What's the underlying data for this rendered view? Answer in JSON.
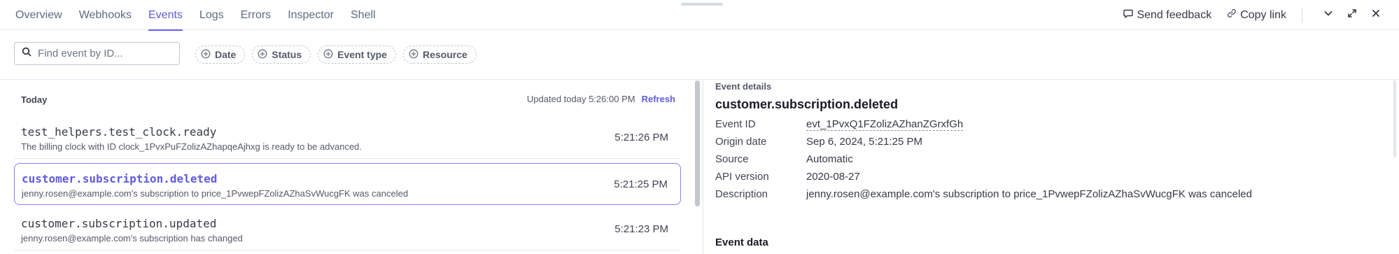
{
  "tabs": [
    {
      "label": "Overview"
    },
    {
      "label": "Webhooks"
    },
    {
      "label": "Events",
      "active": true
    },
    {
      "label": "Logs"
    },
    {
      "label": "Errors"
    },
    {
      "label": "Inspector"
    },
    {
      "label": "Shell"
    }
  ],
  "top_actions": {
    "feedback_label": "Send feedback",
    "copy_link_label": "Copy link"
  },
  "search": {
    "placeholder": "Find event by ID..."
  },
  "filters": [
    {
      "label": "Date"
    },
    {
      "label": "Status"
    },
    {
      "label": "Event type"
    },
    {
      "label": "Resource"
    }
  ],
  "list": {
    "section_title": "Today",
    "updated_text": "Updated today 5:26:00 PM",
    "refresh_label": "Refresh",
    "events": [
      {
        "type": "test_helpers.test_clock.ready",
        "description": "The billing clock with ID clock_1PvxPuFZolizAZhapqeAjhxg is ready to be advanced.",
        "time": "5:21:26 PM"
      },
      {
        "type": "customer.subscription.deleted",
        "description": "jenny.rosen@example.com's subscription to price_1PvwepFZolizAZhaSvWucgFK was canceled",
        "time": "5:21:25 PM",
        "selected": true
      },
      {
        "type": "customer.subscription.updated",
        "description": "jenny.rosen@example.com's subscription has changed",
        "time": "5:21:23 PM"
      }
    ]
  },
  "details": {
    "label": "Event details",
    "title": "customer.subscription.deleted",
    "fields": [
      {
        "key": "Event ID",
        "value": "evt_1PvxQ1FZolizAZhanZGrxfGh"
      },
      {
        "key": "Origin date",
        "value": "Sep 6, 2024, 5:21:25 PM"
      },
      {
        "key": "Source",
        "value": "Automatic"
      },
      {
        "key": "API version",
        "value": "2020-08-27"
      },
      {
        "key": "Description",
        "value": "jenny.rosen@example.com's subscription to price_1PvwepFZolizAZhaSvWucgFK was canceled"
      }
    ],
    "event_data_title": "Event data"
  },
  "colors": {
    "accent": "#635bff",
    "accent_text": "#5f5bdb",
    "border": "#e3e6ea"
  }
}
